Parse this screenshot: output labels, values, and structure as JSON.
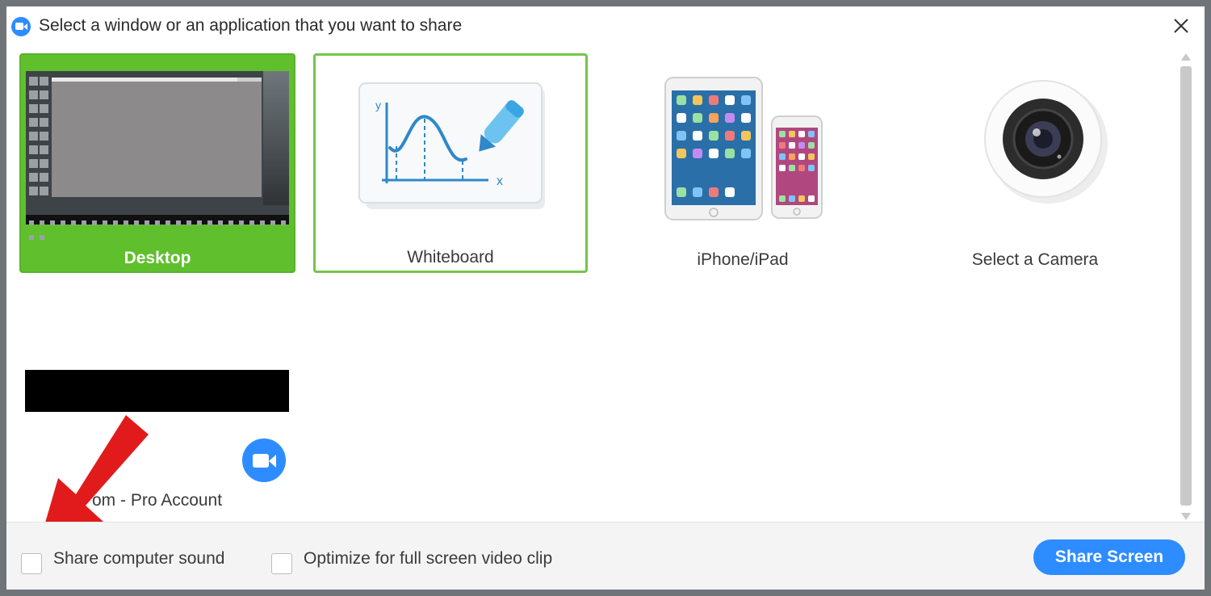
{
  "dialog": {
    "title": "Select a window or an application that you want to share"
  },
  "tiles": [
    {
      "label": "Desktop",
      "selected": true
    },
    {
      "label": "Whiteboard",
      "selected": false
    },
    {
      "label": "iPhone/iPad",
      "selected": false
    },
    {
      "label": "Select a Camera",
      "selected": false
    }
  ],
  "windows": [
    {
      "label": "om - Pro Account",
      "icon": "zoom-app-icon"
    }
  ],
  "footer": {
    "share_sound_label": "Share computer sound",
    "optimize_label": "Optimize for full screen video clip",
    "share_button_label": "Share Screen"
  },
  "colors": {
    "accent_blue": "#2d8cff",
    "selected_green": "#5fbf2d",
    "annotation_red": "#e11b1b"
  }
}
